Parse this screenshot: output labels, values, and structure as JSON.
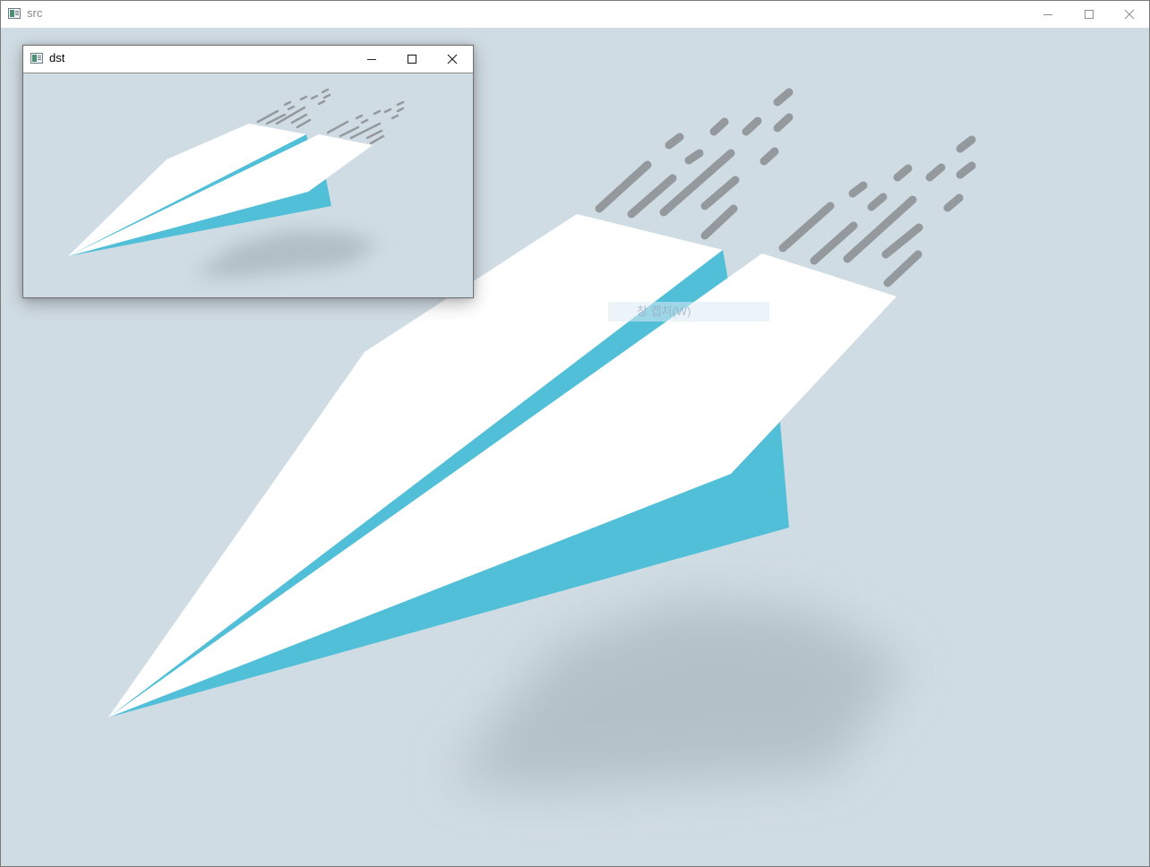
{
  "src_window": {
    "title": "src",
    "controls": {
      "minimize": "minimize-icon",
      "maximize": "maximize-icon",
      "close": "close-icon"
    }
  },
  "dst_window": {
    "title": "dst",
    "controls": {
      "minimize": "minimize-icon",
      "maximize": "maximize-icon",
      "close": "close-icon"
    }
  },
  "overlay": {
    "ghost_tooltip": "창 캡처(W)"
  },
  "colors": {
    "canvas_background": "#d0dce3",
    "plane_paper": "#ffffff",
    "plane_fold": "#50bfd7",
    "speed_lines": "#94999d",
    "shadow": "#9eaab3"
  }
}
